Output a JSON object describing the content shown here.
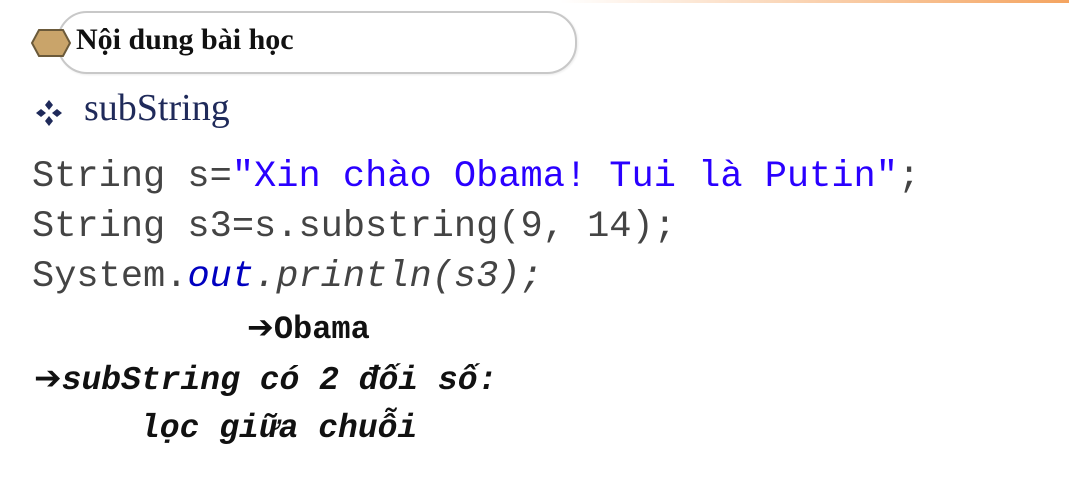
{
  "slide": {
    "title": "Nội dung bài học",
    "bullet": "subString",
    "code": {
      "l1_a": "String s=",
      "l1_str": "\"Xin chào Obama! Tui là Putin\"",
      "l1_end": ";",
      "l2": "String s3=s.substring(9, 14);",
      "l3_a": "System.",
      "l3_field": "out",
      "l3_b": ".println(s3);"
    },
    "arrow": "➔",
    "result": "Obama",
    "note_line1": "subString có 2 đối số:",
    "note_line2": "lọc giữa chuỗi"
  },
  "colors": {
    "accent": "#f4a460",
    "string_literal": "#2a00ff",
    "bullet_text": "#1f2a5a"
  },
  "icons": {
    "title": "hexagon-icon",
    "bullet": "diamond-bullet-icon",
    "arrow": "arrow-right-icon"
  }
}
